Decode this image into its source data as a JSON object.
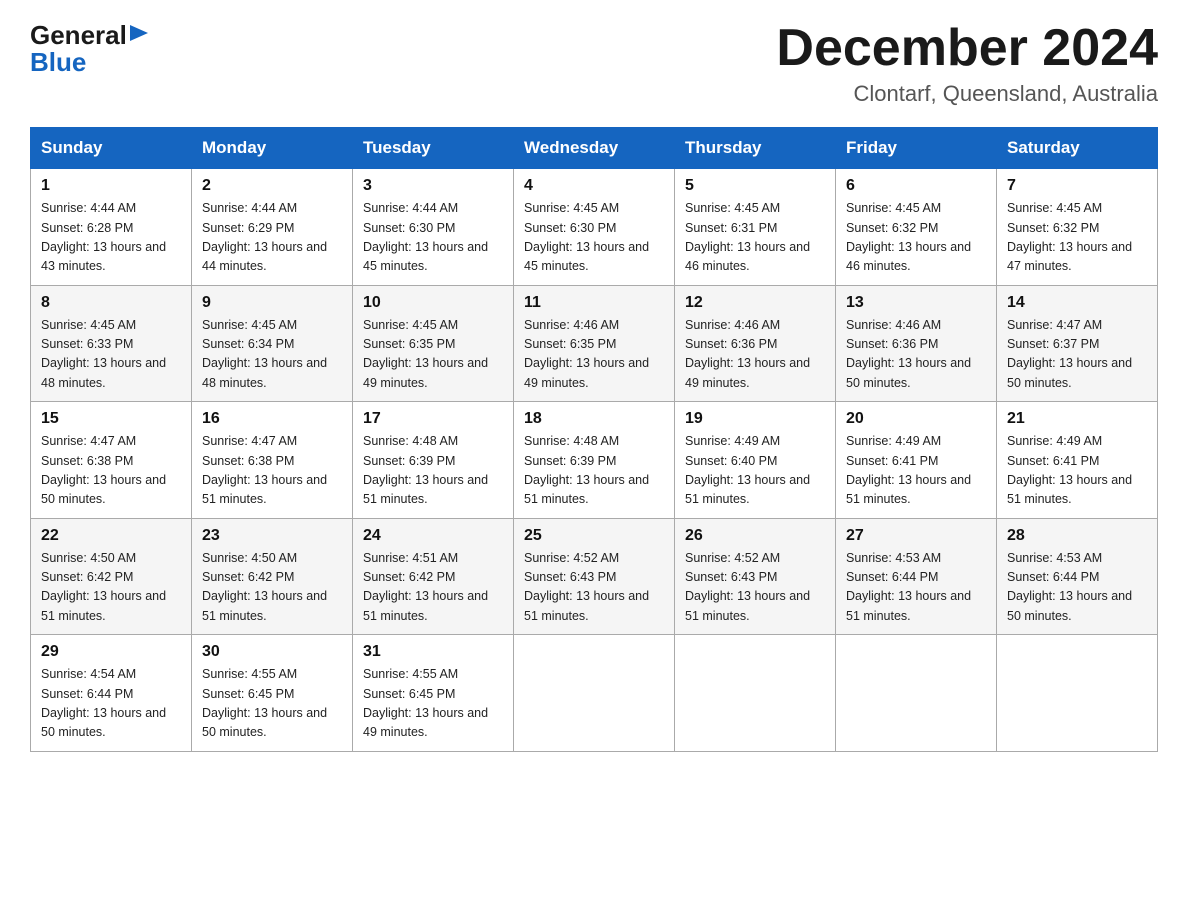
{
  "header": {
    "logo_general": "General",
    "logo_blue": "Blue",
    "month_title": "December 2024",
    "location": "Clontarf, Queensland, Australia"
  },
  "days_of_week": [
    "Sunday",
    "Monday",
    "Tuesday",
    "Wednesday",
    "Thursday",
    "Friday",
    "Saturday"
  ],
  "weeks": [
    [
      {
        "day": "1",
        "sunrise": "4:44 AM",
        "sunset": "6:28 PM",
        "daylight": "13 hours and 43 minutes."
      },
      {
        "day": "2",
        "sunrise": "4:44 AM",
        "sunset": "6:29 PM",
        "daylight": "13 hours and 44 minutes."
      },
      {
        "day": "3",
        "sunrise": "4:44 AM",
        "sunset": "6:30 PM",
        "daylight": "13 hours and 45 minutes."
      },
      {
        "day": "4",
        "sunrise": "4:45 AM",
        "sunset": "6:30 PM",
        "daylight": "13 hours and 45 minutes."
      },
      {
        "day": "5",
        "sunrise": "4:45 AM",
        "sunset": "6:31 PM",
        "daylight": "13 hours and 46 minutes."
      },
      {
        "day": "6",
        "sunrise": "4:45 AM",
        "sunset": "6:32 PM",
        "daylight": "13 hours and 46 minutes."
      },
      {
        "day": "7",
        "sunrise": "4:45 AM",
        "sunset": "6:32 PM",
        "daylight": "13 hours and 47 minutes."
      }
    ],
    [
      {
        "day": "8",
        "sunrise": "4:45 AM",
        "sunset": "6:33 PM",
        "daylight": "13 hours and 48 minutes."
      },
      {
        "day": "9",
        "sunrise": "4:45 AM",
        "sunset": "6:34 PM",
        "daylight": "13 hours and 48 minutes."
      },
      {
        "day": "10",
        "sunrise": "4:45 AM",
        "sunset": "6:35 PM",
        "daylight": "13 hours and 49 minutes."
      },
      {
        "day": "11",
        "sunrise": "4:46 AM",
        "sunset": "6:35 PM",
        "daylight": "13 hours and 49 minutes."
      },
      {
        "day": "12",
        "sunrise": "4:46 AM",
        "sunset": "6:36 PM",
        "daylight": "13 hours and 49 minutes."
      },
      {
        "day": "13",
        "sunrise": "4:46 AM",
        "sunset": "6:36 PM",
        "daylight": "13 hours and 50 minutes."
      },
      {
        "day": "14",
        "sunrise": "4:47 AM",
        "sunset": "6:37 PM",
        "daylight": "13 hours and 50 minutes."
      }
    ],
    [
      {
        "day": "15",
        "sunrise": "4:47 AM",
        "sunset": "6:38 PM",
        "daylight": "13 hours and 50 minutes."
      },
      {
        "day": "16",
        "sunrise": "4:47 AM",
        "sunset": "6:38 PM",
        "daylight": "13 hours and 51 minutes."
      },
      {
        "day": "17",
        "sunrise": "4:48 AM",
        "sunset": "6:39 PM",
        "daylight": "13 hours and 51 minutes."
      },
      {
        "day": "18",
        "sunrise": "4:48 AM",
        "sunset": "6:39 PM",
        "daylight": "13 hours and 51 minutes."
      },
      {
        "day": "19",
        "sunrise": "4:49 AM",
        "sunset": "6:40 PM",
        "daylight": "13 hours and 51 minutes."
      },
      {
        "day": "20",
        "sunrise": "4:49 AM",
        "sunset": "6:41 PM",
        "daylight": "13 hours and 51 minutes."
      },
      {
        "day": "21",
        "sunrise": "4:49 AM",
        "sunset": "6:41 PM",
        "daylight": "13 hours and 51 minutes."
      }
    ],
    [
      {
        "day": "22",
        "sunrise": "4:50 AM",
        "sunset": "6:42 PM",
        "daylight": "13 hours and 51 minutes."
      },
      {
        "day": "23",
        "sunrise": "4:50 AM",
        "sunset": "6:42 PM",
        "daylight": "13 hours and 51 minutes."
      },
      {
        "day": "24",
        "sunrise": "4:51 AM",
        "sunset": "6:42 PM",
        "daylight": "13 hours and 51 minutes."
      },
      {
        "day": "25",
        "sunrise": "4:52 AM",
        "sunset": "6:43 PM",
        "daylight": "13 hours and 51 minutes."
      },
      {
        "day": "26",
        "sunrise": "4:52 AM",
        "sunset": "6:43 PM",
        "daylight": "13 hours and 51 minutes."
      },
      {
        "day": "27",
        "sunrise": "4:53 AM",
        "sunset": "6:44 PM",
        "daylight": "13 hours and 51 minutes."
      },
      {
        "day": "28",
        "sunrise": "4:53 AM",
        "sunset": "6:44 PM",
        "daylight": "13 hours and 50 minutes."
      }
    ],
    [
      {
        "day": "29",
        "sunrise": "4:54 AM",
        "sunset": "6:44 PM",
        "daylight": "13 hours and 50 minutes."
      },
      {
        "day": "30",
        "sunrise": "4:55 AM",
        "sunset": "6:45 PM",
        "daylight": "13 hours and 50 minutes."
      },
      {
        "day": "31",
        "sunrise": "4:55 AM",
        "sunset": "6:45 PM",
        "daylight": "13 hours and 49 minutes."
      },
      null,
      null,
      null,
      null
    ]
  ]
}
